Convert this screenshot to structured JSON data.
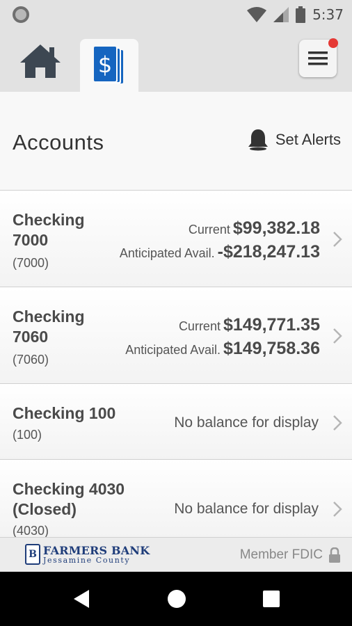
{
  "status_bar": {
    "time": "5:37"
  },
  "tabs": {
    "home_icon": "house-icon",
    "accounts_icon": "dollar-cards-icon",
    "menu_icon": "hamburger-menu-icon",
    "notification_color": "#e53935"
  },
  "header": {
    "title": "Accounts",
    "alerts_label": "Set Alerts",
    "alerts_icon": "bell-icon"
  },
  "accounts": [
    {
      "name_line1": "Checking",
      "name_line2": "7000",
      "number": "(7000)",
      "current_label": "Current",
      "current": "$99,382.18",
      "anticipated_label": "Anticipated Avail.",
      "anticipated": "-$218,247.13"
    },
    {
      "name_line1": "Checking",
      "name_line2": "7060",
      "number": "(7060)",
      "current_label": "Current",
      "current": "$149,771.35",
      "anticipated_label": "Anticipated Avail.",
      "anticipated": "$149,758.36"
    },
    {
      "name_line1": "Checking 100",
      "number": "(100)",
      "balance_text": "No balance for display"
    },
    {
      "name_line1": "Checking 4030",
      "name_line2": "(Closed)",
      "number": "(4030)",
      "balance_text": "No balance for display"
    }
  ],
  "footer": {
    "logo_name": "FARMERS BANK",
    "logo_sub": "Jessamine County",
    "fdic_label": "Member FDIC",
    "lock_icon": "lock-icon",
    "brand_color": "#1f3d7a"
  },
  "colors": {
    "accent": "#1565c0",
    "chrome": "#e2e2e2"
  }
}
